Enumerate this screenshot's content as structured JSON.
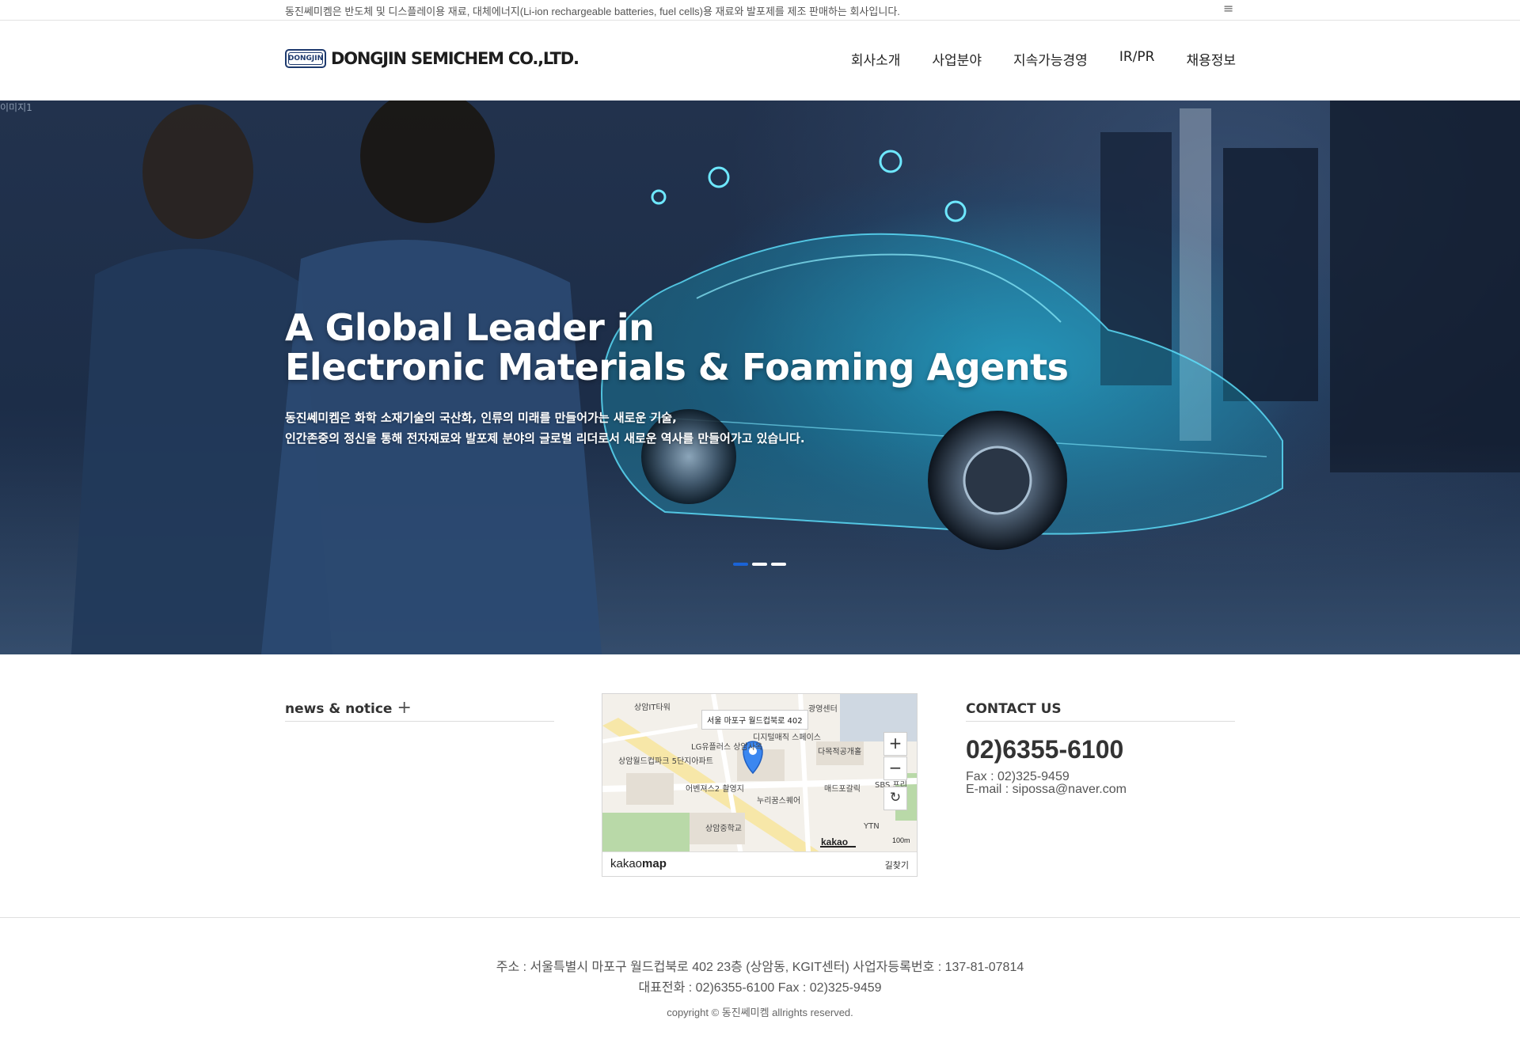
{
  "topbar": {
    "text": "동진쎄미켐은 반도체 및 디스플레이용 재료, 대체에너지(Li-ion rechargeable batteries, fuel cells)용 재료와 발포제를 제조 판매하는 회사입니다.",
    "menu_icon": "≡"
  },
  "header": {
    "logo_badge": "DONGJIN",
    "logo_text": "DONGJIN SEMICHEM CO.,LTD.",
    "nav": [
      "회사소개",
      "사업분야",
      "지속가능경영",
      "IR/PR",
      "채용정보"
    ]
  },
  "hero": {
    "image_alt": "이미지1",
    "title_line1": "A Global Leader in",
    "title_line2": "Electronic Materials & Foaming Agents",
    "sub_line1": "동진쎄미켐은 화학 소재기술의 국산화, 인류의 미래를 만들어가는 새로운 기술,",
    "sub_line2": "인간존중의 정신을 통해 전자재료와 발포제 분야의 글로벌 리더로서 새로운 역사를 만들어가고 있습니다.",
    "slides": 3,
    "active_slide": 1
  },
  "news": {
    "heading": "news & notice",
    "more_icon": "+"
  },
  "map": {
    "address_label": "서울 마포구 월드컵북로 402",
    "labels": [
      "상암IT타워",
      "LG유플러스 상암사옥",
      "디지털매직 스페이스",
      "상암월드컵파크 5단지아파트",
      "어벤져스2 촬영지",
      "누리꿈스퀘어",
      "상암중학교",
      "다목적공개홀",
      "매드포갈릭",
      "SBS 프리",
      "YTN",
      "광영센터"
    ],
    "zoom_in": "+",
    "zoom_out": "−",
    "reset": "↻",
    "brand_light": "kakao",
    "brand_bold": "map",
    "route_label": "길찾기",
    "small_brand": "kakao",
    "scale": "100m"
  },
  "contact": {
    "heading": "CONTACT US",
    "phone": "02)6355-6100",
    "fax": "Fax : 02)325-9459",
    "email": "E-mail : sipossa@naver.com"
  },
  "footer": {
    "address": "주소 : 서울특별시 마포구 월드컵북로 402 23층 (상암동, KGIT센터)  사업자등록번호 : 137-81-07814",
    "tel": "대표전화 : 02)6355-6100  Fax : 02)325-9459",
    "copyright": "copyright © 동진쎄미켐 allrights reserved."
  }
}
